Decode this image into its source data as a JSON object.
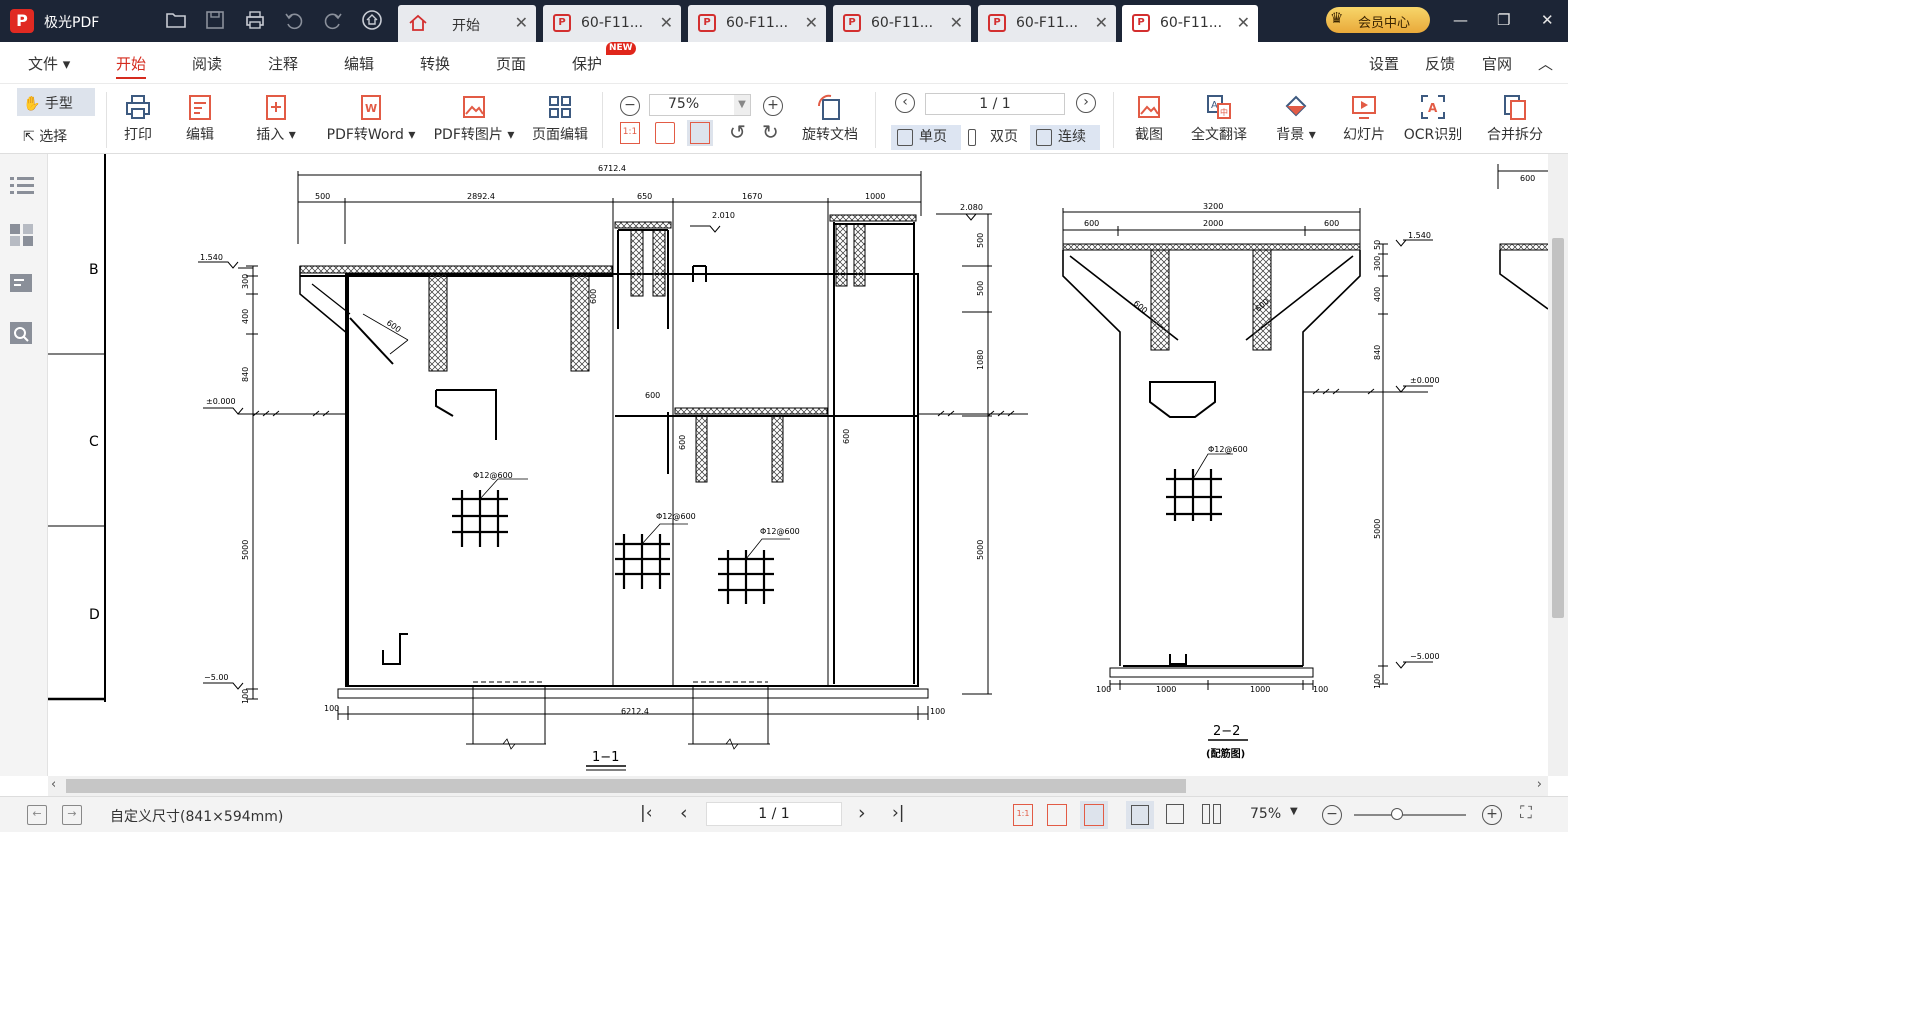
{
  "app": {
    "name": "极光PDF"
  },
  "tabs": [
    {
      "label": "开始",
      "kind": "home"
    },
    {
      "label": "60-F11...",
      "kind": "pdf"
    },
    {
      "label": "60-F11...",
      "kind": "pdf"
    },
    {
      "label": "60-F11...",
      "kind": "pdf"
    },
    {
      "label": "60-F11...",
      "kind": "pdf"
    },
    {
      "label": "60-F11...",
      "kind": "pdf",
      "active": true
    }
  ],
  "vip": {
    "label": "会员中心"
  },
  "menu": {
    "items": [
      "文件",
      "开始",
      "阅读",
      "注释",
      "编辑",
      "转换",
      "页面",
      "保护"
    ],
    "active": "开始",
    "new_badge": "NEW",
    "right": [
      "设置",
      "反馈",
      "官网"
    ]
  },
  "toolbar": {
    "hand": "手型",
    "select": "选择",
    "print": "打印",
    "edit": "编辑",
    "insert": "插入",
    "pdf_to_word": "PDF转Word",
    "pdf_to_image": "PDF转图片",
    "page_edit": "页面编辑",
    "zoom": "75%",
    "rotate_doc": "旋转文档",
    "page_indicator": "1 / 1",
    "single": "单页",
    "double": "双页",
    "continuous": "连续",
    "screenshot": "截图",
    "translate": "全文翻译",
    "background": "背景",
    "slideshow": "幻灯片",
    "ocr": "OCR识别",
    "merge_split": "合并拆分"
  },
  "drawing": {
    "row_labels": [
      "B",
      "C",
      "D"
    ],
    "section1_title": "1−1",
    "section2_title": "2−2",
    "section2_subtitle": "(配筋图)",
    "dims": {
      "total_top": "6712.4",
      "d500": "500",
      "d2892": "2892.4",
      "d650": "650",
      "d1670": "1670",
      "d1000": "1000",
      "el_2080": "2.080",
      "el_2010": "2.010",
      "el_1540": "1.540",
      "el_0": "±0.000",
      "el_m5": "−5.00",
      "d50": "50",
      "d300": "300",
      "d400": "400",
      "d840": "840",
      "d5000": "5000",
      "d100": "100",
      "d600": "600",
      "r500": "500",
      "r1080": "1080",
      "bottom_total": "6212.4",
      "rebar": "Φ12@600",
      "s2_total": "3200",
      "s2_600": "600",
      "s2_2000": "2000",
      "s2_1000": "1000",
      "s2_el_1540": "1.540",
      "s2_el_0": "±0.000",
      "s2_el_m5": "−5.000"
    }
  },
  "status": {
    "page_size": "自定义尺寸(841×594mm)",
    "page": "1 / 1",
    "zoom": "75%"
  }
}
